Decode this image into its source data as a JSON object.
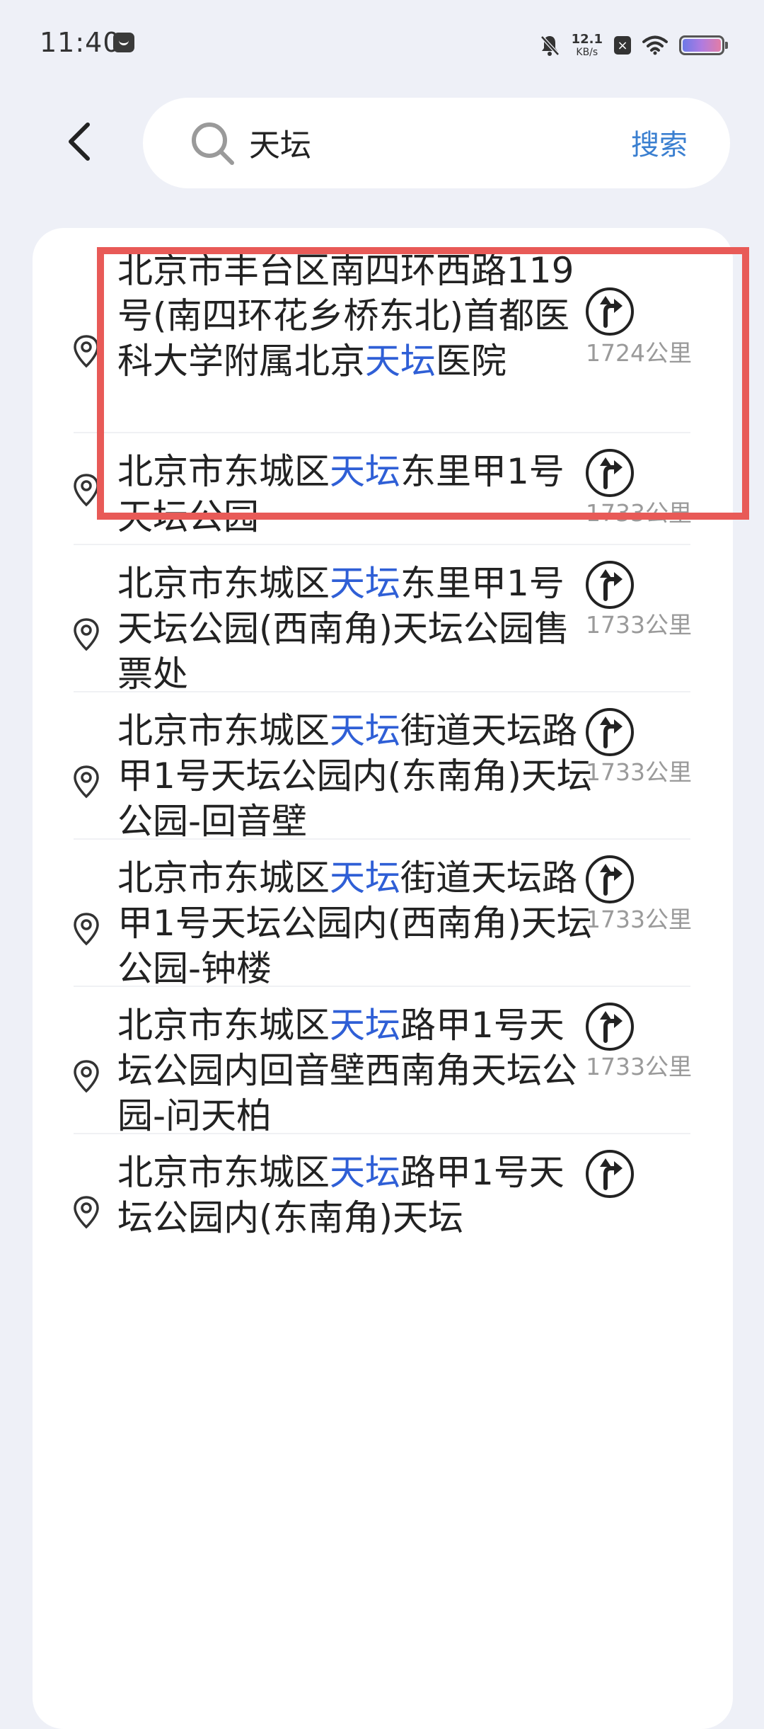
{
  "status_bar": {
    "time": "11:40",
    "net_speed_value": "12.1",
    "net_speed_unit": "KB/s",
    "icons": [
      "app-notification-icon",
      "bell-muted-icon",
      "blocked-icon",
      "wifi-icon",
      "battery-icon"
    ]
  },
  "header": {
    "back_icon": "chevron-left-icon",
    "search_icon": "search-icon",
    "query": "天坛",
    "search_label": "搜索"
  },
  "results": [
    {
      "segments": [
        {
          "t": "北京市丰台区南四环西路119号(南四环花乡桥东北)首都医科大学附属北京",
          "h": false
        },
        {
          "t": "天坛",
          "h": true
        },
        {
          "t": "医院",
          "h": false
        }
      ],
      "distance": "1724公里"
    },
    {
      "segments": [
        {
          "t": "北京市东城区",
          "h": false
        },
        {
          "t": "天坛",
          "h": true
        },
        {
          "t": "东里甲1号天坛公园",
          "h": false
        }
      ],
      "distance": "1733公里"
    },
    {
      "segments": [
        {
          "t": "北京市东城区",
          "h": false
        },
        {
          "t": "天坛",
          "h": true
        },
        {
          "t": "东里甲1号天坛公园(西南角)天坛公园售票处",
          "h": false
        }
      ],
      "distance": "1733公里"
    },
    {
      "segments": [
        {
          "t": "北京市东城区",
          "h": false
        },
        {
          "t": "天坛",
          "h": true
        },
        {
          "t": "街道天坛路甲1号天坛公园内(东南角)天坛公园-回音壁",
          "h": false
        }
      ],
      "distance": "1733公里"
    },
    {
      "segments": [
        {
          "t": "北京市东城区",
          "h": false
        },
        {
          "t": "天坛",
          "h": true
        },
        {
          "t": "街道天坛路甲1号天坛公园内(西南角)天坛公园-钟楼",
          "h": false
        }
      ],
      "distance": "1733公里"
    },
    {
      "segments": [
        {
          "t": "北京市东城区",
          "h": false
        },
        {
          "t": "天坛",
          "h": true
        },
        {
          "t": "路甲1号天坛公园内回音壁西南角天坛公园-问天柏",
          "h": false
        }
      ],
      "distance": "1733公里"
    },
    {
      "segments": [
        {
          "t": "北京市东城区",
          "h": false
        },
        {
          "t": "天坛",
          "h": true
        },
        {
          "t": "路甲1号天坛公园内(东南角)天坛",
          "h": false
        }
      ],
      "distance": ""
    }
  ],
  "colors": {
    "background": "#eef0f7",
    "card": "#ffffff",
    "highlight_text": "#2f5fd6",
    "search_button": "#3a7fd0",
    "selection_frame": "#e85a57",
    "distance_text": "#9a9a9a"
  }
}
